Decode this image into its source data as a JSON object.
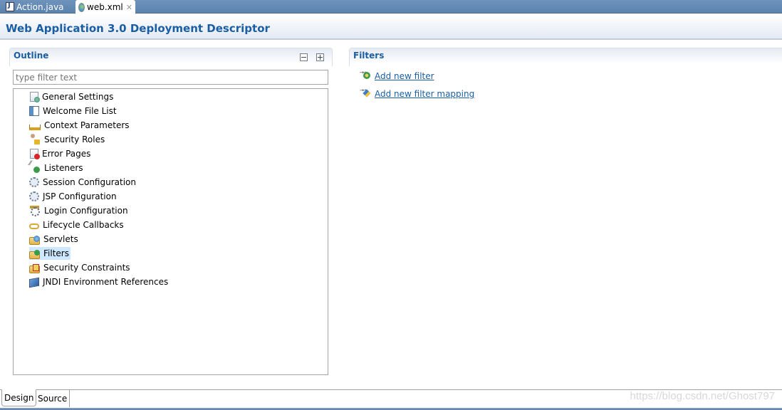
{
  "editor_tabs": [
    {
      "label": "Action.java",
      "icon": "java-file-icon",
      "active": false
    },
    {
      "label": "web.xml",
      "icon": "xml-web-icon",
      "active": true,
      "close": "✕"
    }
  ],
  "header": {
    "title": "Web Application 3.0 Deployment Descriptor"
  },
  "outline": {
    "title": "Outline",
    "collapse_all_tooltip": "collapse-all",
    "expand_all_tooltip": "expand-all",
    "filter_placeholder": "type filter text",
    "filter_value": "",
    "items": [
      {
        "label": "General Settings",
        "icon": "general-settings-icon"
      },
      {
        "label": "Welcome File List",
        "icon": "welcome-file-list-icon"
      },
      {
        "label": "Context Parameters",
        "icon": "context-parameters-icon"
      },
      {
        "label": "Security Roles",
        "icon": "security-roles-icon"
      },
      {
        "label": "Error Pages",
        "icon": "error-pages-icon"
      },
      {
        "label": "Listeners",
        "icon": "listeners-icon"
      },
      {
        "label": "Session Configuration",
        "icon": "session-configuration-icon"
      },
      {
        "label": "JSP Configuration",
        "icon": "jsp-configuration-icon"
      },
      {
        "label": "Login Configuration",
        "icon": "login-configuration-icon"
      },
      {
        "label": "Lifecycle Callbacks",
        "icon": "lifecycle-callbacks-icon"
      },
      {
        "label": "Servlets",
        "icon": "servlets-icon"
      },
      {
        "label": "Filters",
        "icon": "filters-icon",
        "selected": true
      },
      {
        "label": "Security Constraints",
        "icon": "security-constraints-icon"
      },
      {
        "label": "JNDI Environment References",
        "icon": "jndi-references-icon"
      }
    ]
  },
  "details": {
    "title": "Filters",
    "actions": [
      {
        "label": "Add new filter",
        "icon": "add-filter-icon"
      },
      {
        "label": "Add new filter mapping",
        "icon": "add-filter-mapping-icon"
      }
    ]
  },
  "bottom_tabs": [
    {
      "label": "Design",
      "active": true
    },
    {
      "label": "Source",
      "active": false
    }
  ],
  "watermark": "https://blog.csdn.net/Ghost797"
}
